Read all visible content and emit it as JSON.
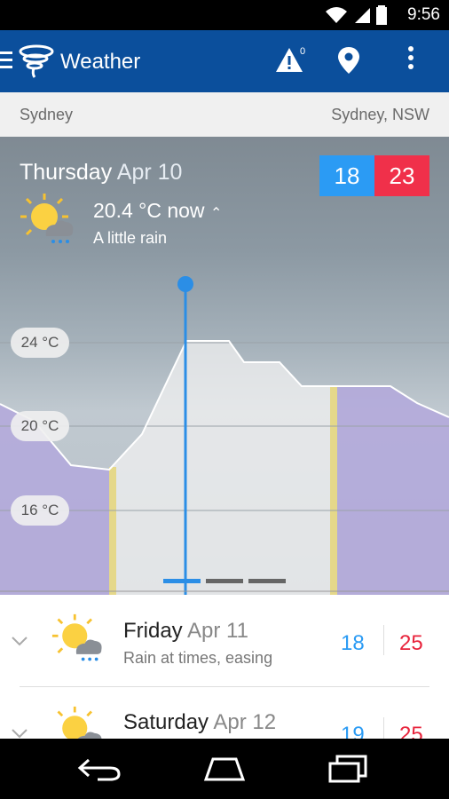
{
  "status": {
    "time": "9:56",
    "icons": [
      "wifi-icon",
      "signal-icon",
      "battery-icon"
    ]
  },
  "appbar": {
    "title": "Weather",
    "warnings_count": "0"
  },
  "location": {
    "left": "Sydney",
    "right": "Sydney, NSW"
  },
  "today": {
    "day": "Thursday",
    "date": "Apr 10",
    "min": "18",
    "max": "23",
    "now": "20.4 °C now",
    "condition": "A little rain",
    "chart_labels": [
      "24 °C",
      "20 °C",
      "16 °C"
    ]
  },
  "forecast": [
    {
      "day": "Friday",
      "date": "Apr 11",
      "condition": "Rain at times, easing",
      "min": "18",
      "max": "25"
    },
    {
      "day": "Saturday",
      "date": "Apr 12",
      "condition": "",
      "min": "19",
      "max": "25"
    }
  ],
  "colors": {
    "appbar": "#0b4f9c",
    "min": "#2b9bf4",
    "max": "#f0304a",
    "night": "#b3a8dc",
    "day": "#f0f0f0"
  }
}
